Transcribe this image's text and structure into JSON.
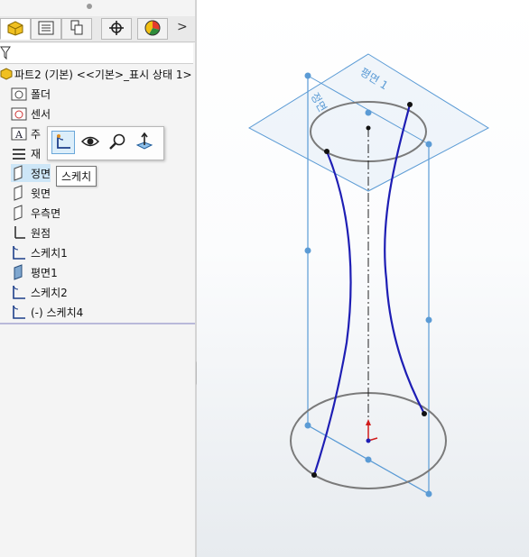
{
  "feature_tree": {
    "root_label": "파트2 (기본) <<기본>_표시 상태 1>",
    "items": [
      {
        "label": "폴더",
        "icon": "folder-icon"
      },
      {
        "label": "센서",
        "icon": "sensor-icon"
      },
      {
        "label": "주",
        "icon": "annotation-icon"
      },
      {
        "label": "재",
        "icon": "material-icon"
      },
      {
        "label": "정면",
        "icon": "plane-icon"
      },
      {
        "label": "윗면",
        "icon": "plane-icon"
      },
      {
        "label": "우측면",
        "icon": "plane-icon"
      },
      {
        "label": "원점",
        "icon": "origin-icon"
      },
      {
        "label": "스케치1",
        "icon": "sketch-icon"
      },
      {
        "label": "평면1",
        "icon": "plane-icon"
      },
      {
        "label": "스케치2",
        "icon": "sketch-icon"
      },
      {
        "label": "(-) 스케치4",
        "icon": "sketch-icon"
      }
    ]
  },
  "context_toolbar": {
    "buttons": [
      "sketch-icon",
      "eye-icon",
      "zoom-to-selection-icon",
      "normal-to-icon"
    ],
    "tooltip": "스케치"
  },
  "viewport": {
    "plane_labels": {
      "top_plane": "평면 1",
      "front_plane": "정면"
    },
    "colors": {
      "plane": "#5b9bd5",
      "sketch": "#1e1eb4",
      "circle": "#7a7a7a",
      "axis": "#222222",
      "origin": "#d11c1c"
    }
  }
}
